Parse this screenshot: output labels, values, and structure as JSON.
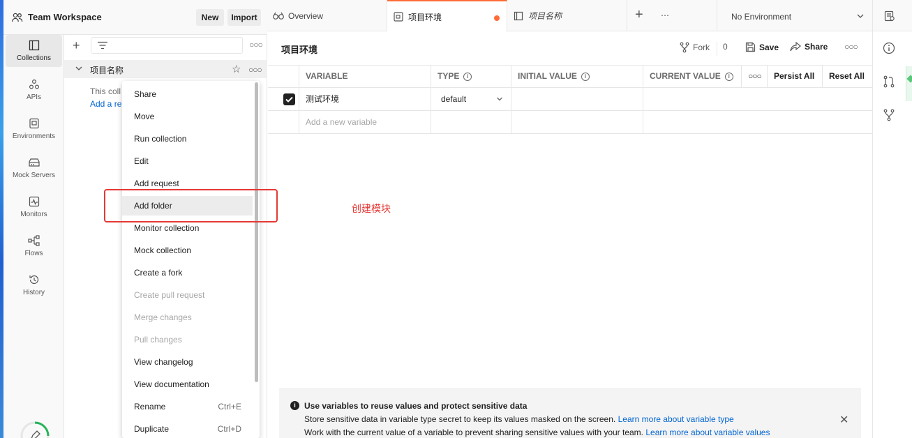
{
  "header": {
    "workspace_title": "Team Workspace",
    "new_label": "New",
    "import_label": "Import"
  },
  "tabs": [
    {
      "label": "Overview"
    },
    {
      "label": "项目环境"
    },
    {
      "label": "项目名称"
    }
  ],
  "tab_more": "⋯",
  "environment_select": {
    "value": "No Environment"
  },
  "nav": [
    {
      "label": "Collections"
    },
    {
      "label": "APIs"
    },
    {
      "label": "Environments"
    },
    {
      "label": "Mock Servers"
    },
    {
      "label": "Monitors"
    },
    {
      "label": "Flows"
    },
    {
      "label": "History"
    }
  ],
  "sidebar": {
    "collection_name": "项目名称",
    "empty_text": "This coll",
    "empty_link": "Add a re"
  },
  "context_menu": [
    {
      "label": "Share",
      "shortcut": ""
    },
    {
      "label": "Move",
      "shortcut": ""
    },
    {
      "label": "Run collection",
      "shortcut": ""
    },
    {
      "label": "Edit",
      "shortcut": ""
    },
    {
      "label": "Add request",
      "shortcut": ""
    },
    {
      "label": "Add folder",
      "shortcut": ""
    },
    {
      "label": "Monitor collection",
      "shortcut": ""
    },
    {
      "label": "Mock collection",
      "shortcut": ""
    },
    {
      "label": "Create a fork",
      "shortcut": ""
    },
    {
      "label": "Create pull request",
      "shortcut": ""
    },
    {
      "label": "Merge changes",
      "shortcut": ""
    },
    {
      "label": "Pull changes",
      "shortcut": ""
    },
    {
      "label": "View changelog",
      "shortcut": ""
    },
    {
      "label": "View documentation",
      "shortcut": ""
    },
    {
      "label": "Rename",
      "shortcut": "Ctrl+E"
    },
    {
      "label": "Duplicate",
      "shortcut": "Ctrl+D"
    }
  ],
  "annotation": "创建模块",
  "environment": {
    "title": "项目环境",
    "fork_label": "Fork",
    "fork_count": "0",
    "save_label": "Save",
    "share_label": "Share"
  },
  "table": {
    "headers": {
      "variable": "VARIABLE",
      "type": "TYPE",
      "initial": "INITIAL VALUE",
      "current": "CURRENT VALUE",
      "persist": "Persist All",
      "reset": "Reset All"
    },
    "rows": [
      {
        "variable": "测试环境",
        "type": "default",
        "initial": "",
        "current": ""
      }
    ],
    "new_placeholder": "Add a new variable"
  },
  "banner": {
    "title": "Use variables to reuse values and protect sensitive data",
    "line1": "Store sensitive data in variable type secret to keep its values masked on the screen.",
    "link1": "Learn more about variable type",
    "line2": "Work with the current value of a variable to prevent sharing sensitive values with your team.",
    "link2": "Learn more about variable values"
  },
  "colors": {
    "accent": "#ff6c37",
    "link": "#0265d2",
    "annotation": "#e53935"
  }
}
